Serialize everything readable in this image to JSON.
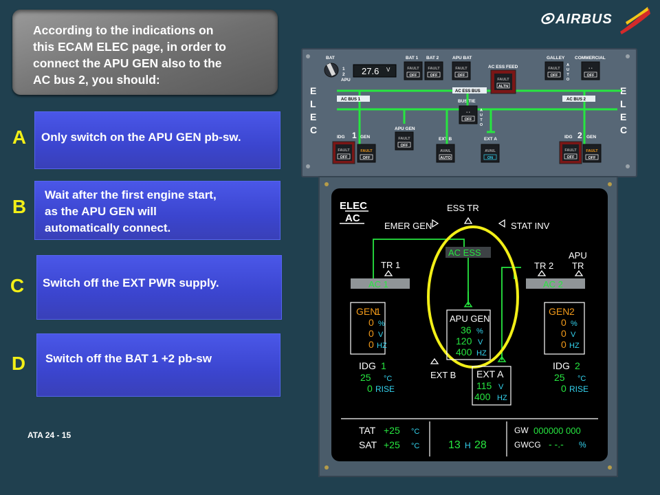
{
  "question": {
    "lines": [
      "According to the indications on",
      "this ECAM  ELEC page, in order to",
      "connect the APU GEN also to the",
      "AC bus 2, you should:"
    ]
  },
  "answers": [
    {
      "letter": "A",
      "lines": [
        "Only switch on the APU GEN pb-sw."
      ]
    },
    {
      "letter": "B",
      "lines": [
        "Wait after the first engine start,",
        "as the APU GEN will",
        "automatically connect."
      ]
    },
    {
      "letter": "C",
      "lines": [
        "Switch off the EXT PWR supply."
      ]
    },
    {
      "letter": "D",
      "lines": [
        "Switch off the BAT 1 +2 pb-sw"
      ]
    }
  ],
  "footer": {
    "ata": "ATA 24 - 15"
  },
  "brand": {
    "name": "AIRBUS"
  },
  "overhead": {
    "side_letters": [
      "E",
      "L",
      "E",
      "C"
    ],
    "bat_label": "BAT",
    "bat_display": "27.6",
    "bat_unit": "V",
    "bat_sel": [
      "1",
      "2",
      "APU"
    ],
    "bat1": "BAT 1",
    "bat2": "BAT 2",
    "apu_bat": "APU BAT",
    "ac_ess_feed": "AC ESS FEED",
    "galley": "GALLEY",
    "commercial": "COMMERCIAL",
    "fault": "FAULT",
    "off": "OFF",
    "altn": "ALTN",
    "auto": "AUTO",
    "avail": "AVAIL",
    "on": "ON",
    "dots": "• •",
    "ac_bus1": "AC BUS 1",
    "ac_ess_bus": "AC ESS BUS",
    "ac_bus2": "AC BUS 2",
    "bus_tie": "BUS TIE",
    "idg": "IDG",
    "gen": "GEN",
    "apu_gen": "APU GEN",
    "ext_b": "EXT B",
    "ext_a": "EXT A",
    "num1": "1",
    "num2": "2"
  },
  "ecam": {
    "title1": "ELEC",
    "title2": "AC",
    "ess_tr": "ESS TR",
    "emer_gen": "EMER GEN",
    "stat_inv": "STAT INV",
    "ac_ess": "AC ESS",
    "tr1": "TR 1",
    "tr2": "TR 2",
    "apu_tr1": "APU",
    "apu_tr2": "TR",
    "ac1": "AC 1",
    "ac2": "AC 2",
    "gen1": {
      "label": "GEN",
      "num": "1",
      "load": "0",
      "volt": "0",
      "freq": "0"
    },
    "gen2": {
      "label": "GEN",
      "num": "2",
      "load": "0",
      "volt": "0",
      "freq": "0"
    },
    "apu_gen": {
      "label": "APU GEN",
      "load": "36",
      "volt": "120",
      "freq": "400"
    },
    "ext_a": {
      "label": "EXT A",
      "volt": "115",
      "freq": "400"
    },
    "ext_b": "EXT B",
    "idg1": {
      "label": "IDG",
      "num": "1",
      "temp": "25",
      "rise_val": "0"
    },
    "idg2": {
      "label": "IDG",
      "num": "2",
      "temp": "25",
      "rise_val": "0"
    },
    "units": {
      "pct": "%",
      "v": "V",
      "hz": "HZ",
      "degc": "°C",
      "rise": "RISE"
    },
    "footer": {
      "tat": "TAT",
      "tat_val": "+25",
      "sat": "SAT",
      "sat_val": "+25",
      "degc": "°C",
      "time_h": "13",
      "time_label": "H",
      "time_m": "28",
      "gw": "GW",
      "gw_val": "000000 000",
      "gwcg": "GWCG",
      "gwcg_val": "- -.-",
      "gwcg_unit": "%"
    }
  },
  "colors": {
    "accent": "#f2ef17",
    "ecam_green": "#27e640",
    "ecam_amber": "#f29a1a",
    "ecam_cyan": "#34d4f0"
  }
}
